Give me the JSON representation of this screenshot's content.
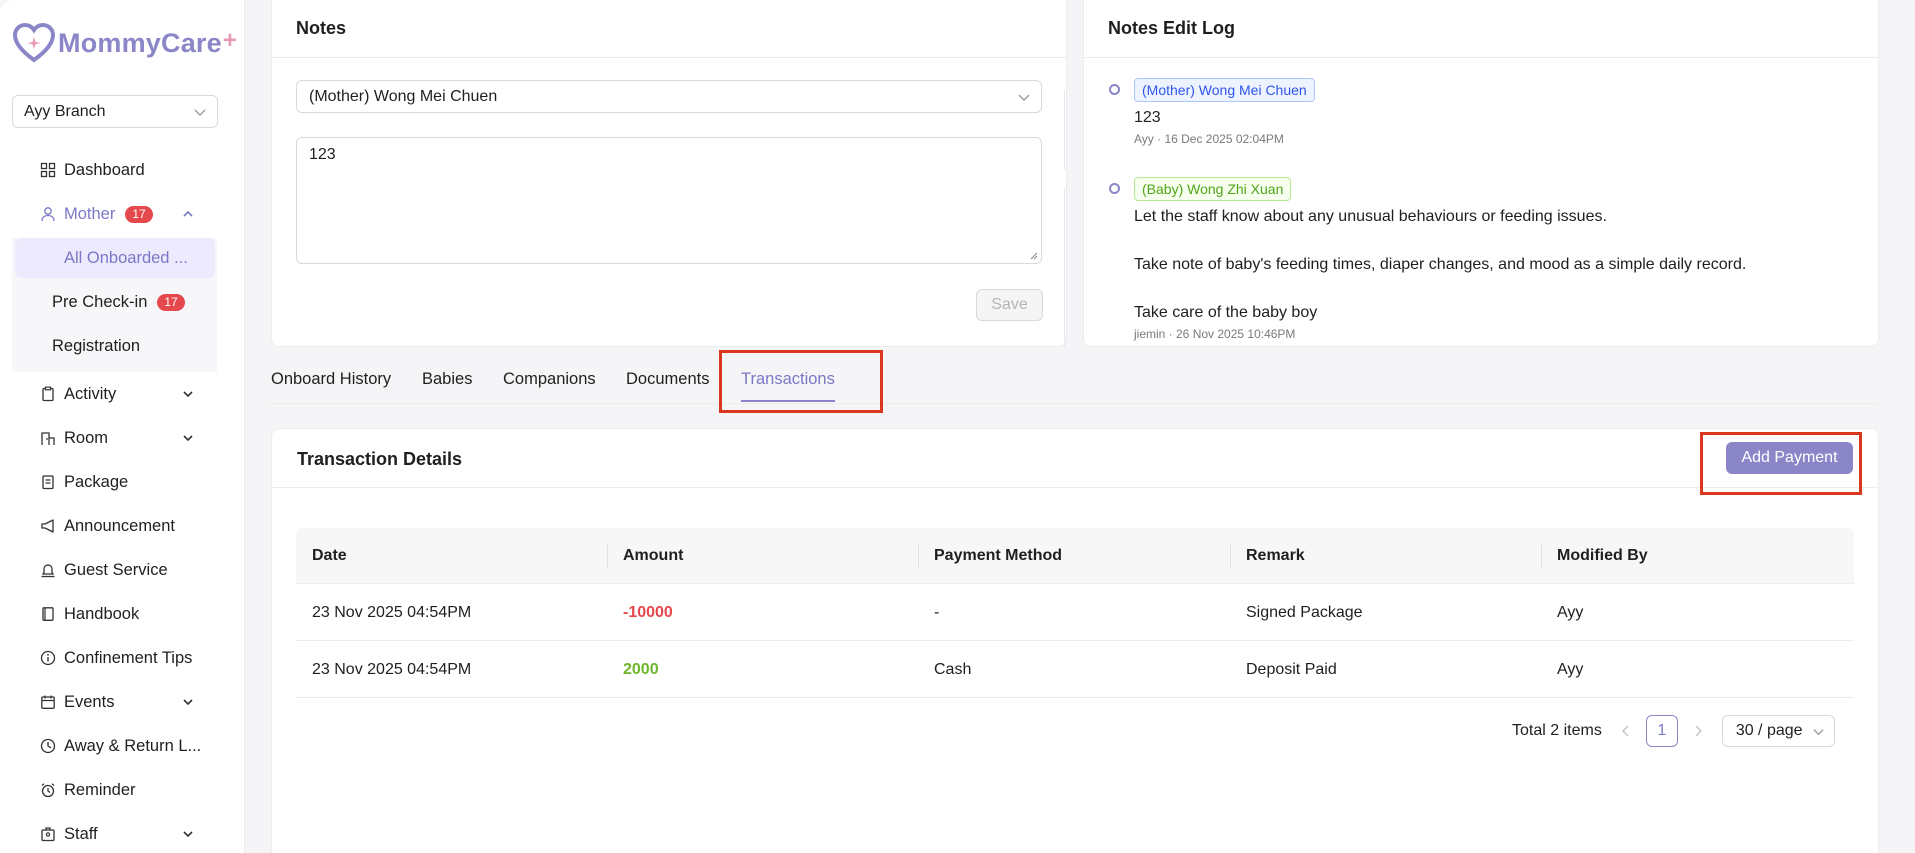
{
  "brand": {
    "name": "MommyCare",
    "plus": "+"
  },
  "branch": {
    "selected": "Ayy Branch"
  },
  "sidebar": {
    "items": [
      {
        "label": "Dashboard"
      },
      {
        "label": "Mother",
        "badge": "17"
      },
      {
        "label": "Activity"
      },
      {
        "label": "Room"
      },
      {
        "label": "Package"
      },
      {
        "label": "Announcement"
      },
      {
        "label": "Guest Service"
      },
      {
        "label": "Handbook"
      },
      {
        "label": "Confinement Tips"
      },
      {
        "label": "Events"
      },
      {
        "label": "Away & Return L..."
      },
      {
        "label": "Reminder"
      },
      {
        "label": "Staff"
      }
    ],
    "mother_sub": [
      {
        "label": "All Onboarded ..."
      },
      {
        "label": "Pre Check-in",
        "badge": "17"
      },
      {
        "label": "Registration"
      }
    ]
  },
  "notes": {
    "title": "Notes",
    "subject": "(Mother) Wong Mei Chuen",
    "text": "123",
    "save_label": "Save"
  },
  "notes_log": {
    "title": "Notes Edit Log",
    "entries": [
      {
        "tag": "(Mother) Wong Mei Chuen",
        "text": "123",
        "meta": "Ayy · 16 Dec 2025 02:04PM"
      },
      {
        "tag": "(Baby) Wong Zhi Xuan",
        "paragraphs": [
          "Let the staff know about any unusual behaviours or feeding issues.",
          "Take note of baby's feeding times, diaper changes, and mood as a simple daily record.",
          "Take care of the baby boy"
        ],
        "meta": "jiemin · 26 Nov 2025 10:46PM"
      }
    ]
  },
  "tabs": [
    {
      "label": "Onboard History"
    },
    {
      "label": "Babies"
    },
    {
      "label": "Companions"
    },
    {
      "label": "Documents"
    },
    {
      "label": "Transactions"
    }
  ],
  "transactions": {
    "title": "Transaction Details",
    "add_label": "Add Payment",
    "columns": [
      "Date",
      "Amount",
      "Payment Method",
      "Remark",
      "Modified By"
    ],
    "rows": [
      {
        "date": "23 Nov 2025 04:54PM",
        "amount": "-10000",
        "method": "-",
        "remark": "Signed Package",
        "by": "Ayy"
      },
      {
        "date": "23 Nov 2025 04:54PM",
        "amount": "2000",
        "method": "Cash",
        "remark": "Deposit Paid",
        "by": "Ayy"
      }
    ],
    "total": "Total 2 items",
    "page": "1",
    "page_size": "30 / page"
  },
  "colors": {
    "accent": "#8a86c8",
    "negative": "#e5484d",
    "positive": "#6fb52c",
    "highlight": "#d9381e"
  }
}
